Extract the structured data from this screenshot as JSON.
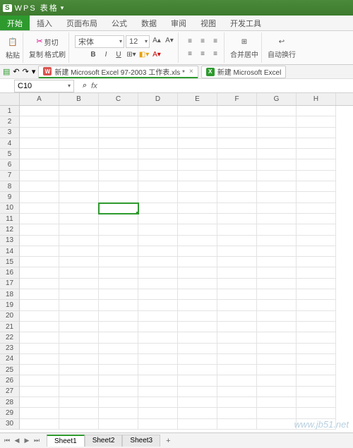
{
  "titlebar": {
    "logo": "S",
    "app_name": "WPS 表格"
  },
  "menu": {
    "tabs": [
      "开始",
      "插入",
      "页面布局",
      "公式",
      "数据",
      "审阅",
      "视图",
      "开发工具"
    ],
    "active_index": 0
  },
  "ribbon": {
    "paste": "粘贴",
    "cut": "剪切",
    "copy": "复制",
    "format_painter": "格式刷",
    "font_name": "宋体",
    "font_size": "12",
    "bold": "B",
    "italic": "I",
    "underline": "U",
    "merge_center": "合并居中",
    "auto_wrap": "自动换行"
  },
  "qat": {
    "doc1": "新建 Microsoft Excel 97-2003 工作表.xls *",
    "doc2": "新建 Microsoft Excel"
  },
  "formula": {
    "cell_ref": "C10",
    "search_icon": "⌕",
    "fx": "fx"
  },
  "grid": {
    "columns": [
      "A",
      "B",
      "C",
      "D",
      "E",
      "F",
      "G",
      "H"
    ],
    "row_count": 30,
    "selected": {
      "row": 10,
      "col": "C"
    }
  },
  "sheets": {
    "tabs": [
      "Sheet1",
      "Sheet2",
      "Sheet3"
    ],
    "active_index": 0,
    "add": "+"
  },
  "watermark": "www.jb51.net"
}
